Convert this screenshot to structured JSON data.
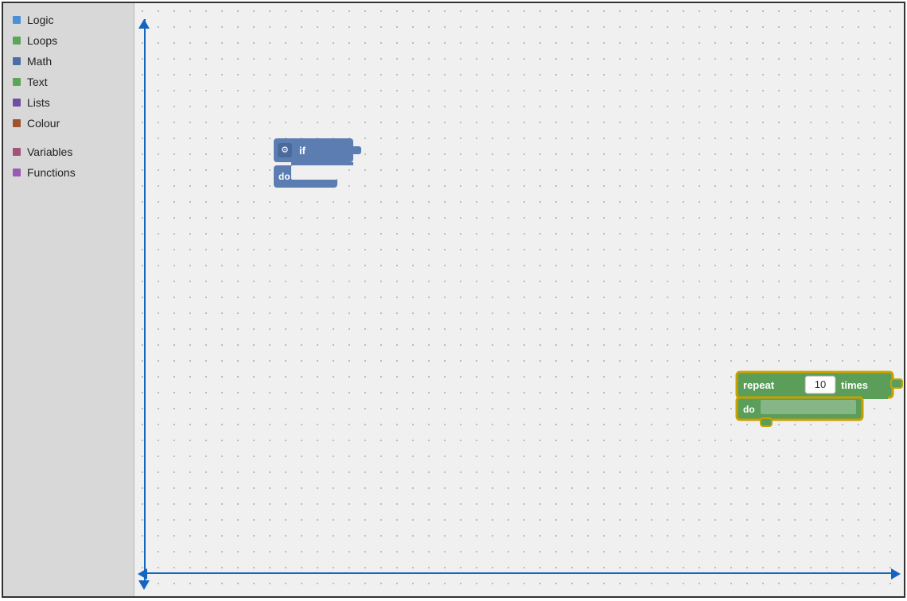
{
  "sidebar": {
    "items": [
      {
        "id": "logic",
        "label": "Logic",
        "color": "#4a90d9"
      },
      {
        "id": "loops",
        "label": "Loops",
        "color": "#5ba55b"
      },
      {
        "id": "math",
        "label": "Math",
        "color": "#4a6fa5"
      },
      {
        "id": "text",
        "label": "Text",
        "color": "#5ba55b"
      },
      {
        "id": "lists",
        "label": "Lists",
        "color": "#6e4ea5"
      },
      {
        "id": "colour",
        "label": "Colour",
        "color": "#a0522d"
      },
      {
        "id": "variables",
        "label": "Variables",
        "color": "#a3527a"
      },
      {
        "id": "functions",
        "label": "Functions",
        "color": "#9b59b6"
      }
    ]
  },
  "blocks": {
    "if_block": {
      "label_if": "if",
      "label_do": "do"
    },
    "repeat_block": {
      "label_repeat": "repeat",
      "label_times": "times",
      "label_do": "do",
      "value": "10"
    }
  }
}
